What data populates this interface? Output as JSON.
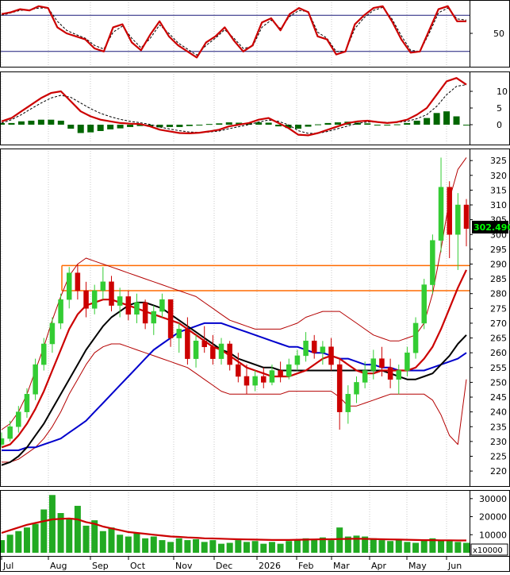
{
  "colors": {
    "background": "#ffffff",
    "frame": "#000000",
    "grid": "#c8c8c8",
    "up_candle": "#33cc33",
    "down_candle": "#cc0000",
    "ma_red": "#cc0000",
    "ma_black": "#000000",
    "ma_blue": "#0000cc",
    "bollinger": "#b40000",
    "resistance": "#ff6a00",
    "stoch_main": "#cc0000",
    "stoch_signal": "#000000",
    "stoch_levels": "#1a1a7a",
    "macd_line": "#cc0000",
    "macd_signal": "#000000",
    "macd_hist": "#006600",
    "volume_bar": "#22aa22",
    "volume_ma": "#cc0000",
    "price_tag_bg": "#000000",
    "price_tag_text": "#00ff00"
  },
  "chart_data": [
    {
      "panel": "stochastic",
      "type": "line",
      "x_labels": [
        "Jul",
        "Aug",
        "Sep",
        "Oct",
        "Nov",
        "Dec",
        "2026",
        "Feb",
        "Mar",
        "Apr",
        "May",
        "Jun"
      ],
      "ylim": [
        0,
        100
      ],
      "yticks": [
        "50"
      ],
      "levels": [
        80,
        20
      ],
      "grid": true,
      "series": [
        {
          "role": "main",
          "values": [
            82,
            85,
            90,
            88,
            95,
            92,
            60,
            50,
            45,
            40,
            25,
            20,
            60,
            65,
            35,
            22,
            48,
            70,
            45,
            30,
            20,
            10,
            35,
            45,
            60,
            38,
            20,
            30,
            68,
            75,
            55,
            82,
            92,
            85,
            45,
            40,
            15,
            20,
            65,
            80,
            92,
            95,
            70,
            40,
            18,
            20,
            55,
            90,
            95,
            70,
            70
          ]
        },
        {
          "role": "signal",
          "values": [
            80,
            84,
            88,
            89,
            92,
            92,
            70,
            55,
            48,
            42,
            30,
            24,
            52,
            62,
            42,
            26,
            42,
            64,
            50,
            34,
            24,
            14,
            30,
            42,
            56,
            42,
            25,
            28,
            60,
            72,
            58,
            78,
            88,
            86,
            52,
            42,
            20,
            20,
            58,
            76,
            88,
            93,
            74,
            46,
            22,
            20,
            50,
            84,
            92,
            74,
            72
          ]
        }
      ]
    },
    {
      "panel": "macd",
      "type": "line",
      "ylim": [
        -5,
        15
      ],
      "yticks": [
        "10",
        "5",
        "0"
      ],
      "grid": true,
      "series": [
        {
          "role": "macd",
          "values": [
            1,
            2,
            4,
            6,
            8,
            9.5,
            10,
            7,
            4,
            2.5,
            1.5,
            1,
            0.5,
            0.3,
            0.2,
            -0.5,
            -1.5,
            -2,
            -2.5,
            -2.6,
            -2.4,
            -2,
            -1.5,
            -0.5,
            0,
            0.5,
            1.5,
            2,
            0.5,
            -1,
            -3,
            -3.2,
            -2.5,
            -1.5,
            -0.5,
            0.5,
            1,
            1.2,
            0.8,
            0.5,
            0.8,
            1.5,
            3,
            5,
            9,
            13,
            14,
            12
          ]
        },
        {
          "role": "signal",
          "values": [
            0.5,
            1.5,
            3,
            4.8,
            6.5,
            8,
            8.8,
            8.2,
            6.5,
            4.8,
            3.4,
            2.4,
            1.6,
            1,
            0.6,
            0.1,
            -0.7,
            -1.3,
            -1.8,
            -2.2,
            -2.3,
            -2.2,
            -1.9,
            -1.2,
            -0.6,
            0,
            0.8,
            1.4,
            1,
            0,
            -1.8,
            -2.6,
            -2.6,
            -2,
            -1.2,
            -0.4,
            0.4,
            0.8,
            0.8,
            0.7,
            0.7,
            1,
            1.8,
            3,
            5.5,
            9,
            11.5,
            12
          ]
        },
        {
          "role": "histogram",
          "values": [
            0.5,
            0.5,
            1,
            1.2,
            1.5,
            1.5,
            1.2,
            -1.2,
            -2.5,
            -2.3,
            -1.9,
            -1.4,
            -1.1,
            -0.7,
            -0.4,
            -0.6,
            -0.8,
            -0.7,
            -0.7,
            -0.4,
            -0.1,
            0.2,
            0.4,
            0.7,
            0.6,
            0.5,
            0.7,
            0.6,
            -0.5,
            -1,
            -1.2,
            -0.6,
            0.1,
            0.5,
            0.7,
            0.9,
            0.6,
            0.4,
            0,
            -0.2,
            0.1,
            0.5,
            1.2,
            2,
            3.5,
            4,
            2.5,
            0
          ]
        }
      ]
    },
    {
      "panel": "price",
      "type": "candlestick",
      "ylim": [
        216,
        328
      ],
      "yticks": [
        "325",
        "320",
        "315",
        "310",
        "305",
        "300",
        "295",
        "290",
        "285",
        "280",
        "275",
        "270",
        "265",
        "260",
        "255",
        "250",
        "245",
        "240",
        "235",
        "230",
        "225",
        "220"
      ],
      "last_price": "302.490",
      "levels": [
        289.5,
        281
      ],
      "candles": [
        [
          229,
          233,
          228,
          231
        ],
        [
          231,
          237,
          230,
          235
        ],
        [
          235,
          242,
          233,
          240
        ],
        [
          240,
          248,
          238,
          246
        ],
        [
          246,
          258,
          244,
          256
        ],
        [
          256,
          265,
          254,
          263
        ],
        [
          263,
          272,
          260,
          270
        ],
        [
          270,
          280,
          268,
          278
        ],
        [
          278,
          289,
          275,
          287
        ],
        [
          287,
          290,
          278,
          281
        ],
        [
          281,
          284,
          272,
          275
        ],
        [
          275,
          283,
          273,
          281
        ],
        [
          281,
          289,
          278,
          284
        ],
        [
          284,
          286,
          274,
          276
        ],
        [
          276,
          282,
          272,
          279
        ],
        [
          279,
          281,
          271,
          273
        ],
        [
          273,
          280,
          270,
          277
        ],
        [
          277,
          278,
          268,
          270
        ],
        [
          270,
          276,
          266,
          274
        ],
        [
          274,
          280,
          272,
          278
        ],
        [
          278,
          278,
          262,
          265
        ],
        [
          265,
          270,
          260,
          268
        ],
        [
          268,
          272,
          256,
          258
        ],
        [
          258,
          266,
          255,
          264
        ],
        [
          264,
          269,
          260,
          262
        ],
        [
          262,
          266,
          256,
          258
        ],
        [
          258,
          265,
          256,
          263
        ],
        [
          263,
          264,
          254,
          256
        ],
        [
          256,
          260,
          250,
          252
        ],
        [
          252,
          256,
          246,
          249
        ],
        [
          249,
          254,
          247,
          252
        ],
        [
          252,
          255,
          248,
          250
        ],
        [
          250,
          256,
          249,
          254
        ],
        [
          254,
          257,
          250,
          252
        ],
        [
          252,
          258,
          251,
          256
        ],
        [
          256,
          261,
          254,
          259
        ],
        [
          259,
          267,
          257,
          264
        ],
        [
          264,
          266,
          258,
          260
        ],
        [
          260,
          264,
          256,
          262
        ],
        [
          262,
          265,
          254,
          256
        ],
        [
          256,
          258,
          234,
          240
        ],
        [
          240,
          249,
          236,
          246
        ],
        [
          246,
          252,
          243,
          250
        ],
        [
          250,
          257,
          248,
          254
        ],
        [
          254,
          261,
          251,
          258
        ],
        [
          258,
          262,
          252,
          255
        ],
        [
          255,
          258,
          248,
          251
        ],
        [
          251,
          256,
          246,
          254
        ],
        [
          254,
          262,
          252,
          260
        ],
        [
          260,
          272,
          258,
          270
        ],
        [
          270,
          285,
          268,
          283
        ],
        [
          283,
          300,
          280,
          298
        ],
        [
          298,
          326,
          294,
          316
        ],
        [
          316,
          318,
          292,
          300
        ],
        [
          300,
          314,
          288,
          310
        ],
        [
          310,
          312,
          296,
          302
        ]
      ],
      "series": [
        {
          "role": "ma_red",
          "values": [
            228,
            229,
            232,
            236,
            241,
            247,
            254,
            261,
            268,
            273,
            276,
            277,
            278,
            278,
            277,
            276,
            275,
            274,
            273,
            272,
            271,
            270,
            268,
            266,
            264,
            262,
            261,
            259,
            257,
            255,
            254,
            253,
            252,
            252,
            252,
            253,
            254,
            256,
            258,
            259,
            258,
            256,
            254,
            253,
            253,
            254,
            254,
            254,
            254,
            255,
            258,
            262,
            268,
            275,
            282,
            288
          ]
        },
        {
          "role": "ma_black",
          "values": [
            222,
            223,
            225,
            228,
            232,
            236,
            241,
            246,
            251,
            256,
            261,
            265,
            269,
            272,
            274,
            276,
            277,
            277,
            276,
            275,
            273,
            271,
            269,
            267,
            265,
            263,
            261,
            260,
            258,
            257,
            256,
            255,
            255,
            254,
            254,
            254,
            254,
            254,
            254,
            254,
            254,
            254,
            254,
            254,
            254,
            254,
            253,
            252,
            251,
            251,
            252,
            253,
            256,
            259,
            263,
            266
          ]
        },
        {
          "role": "ma_blue",
          "values": [
            227,
            227,
            227,
            228,
            228,
            229,
            230,
            231,
            233,
            235,
            237,
            240,
            243,
            246,
            249,
            252,
            255,
            258,
            261,
            263,
            265,
            267,
            268,
            269,
            270,
            270,
            270,
            269,
            268,
            267,
            266,
            265,
            264,
            263,
            262,
            262,
            261,
            260,
            260,
            259,
            258,
            258,
            257,
            256,
            256,
            255,
            255,
            254,
            254,
            254,
            254,
            255,
            256,
            257,
            258,
            260
          ]
        },
        {
          "role": "boll_upper",
          "values": [
            234,
            236,
            240,
            246,
            254,
            262,
            271,
            279,
            286,
            290,
            292,
            291,
            290,
            289,
            288,
            287,
            286,
            285,
            284,
            283,
            282,
            281,
            280,
            279,
            277,
            275,
            273,
            271,
            270,
            269,
            268,
            268,
            268,
            268,
            269,
            270,
            272,
            273,
            274,
            274,
            274,
            272,
            270,
            268,
            266,
            265,
            264,
            264,
            265,
            266,
            270,
            280,
            295,
            312,
            322,
            326
          ]
        },
        {
          "role": "boll_lower",
          "values": [
            223,
            223,
            224,
            226,
            228,
            231,
            235,
            240,
            246,
            251,
            256,
            260,
            262,
            263,
            263,
            262,
            261,
            260,
            259,
            258,
            257,
            256,
            255,
            253,
            251,
            249,
            247,
            246,
            246,
            246,
            246,
            246,
            246,
            246,
            247,
            247,
            247,
            247,
            247,
            247,
            245,
            242,
            242,
            243,
            244,
            245,
            246,
            246,
            246,
            246,
            246,
            244,
            239,
            232,
            229,
            251
          ]
        }
      ]
    },
    {
      "panel": "volume",
      "type": "bar",
      "yticks": [
        "30000",
        "20000",
        "10000"
      ],
      "unit_label": "x10000",
      "grid": true,
      "values": [
        7000,
        10000,
        12000,
        14000,
        16000,
        24000,
        32000,
        22000,
        19000,
        26000,
        15000,
        18000,
        12000,
        14000,
        10000,
        9000,
        11000,
        8000,
        9000,
        7000,
        6000,
        8000,
        7000,
        7500,
        6000,
        7000,
        5000,
        5500,
        7000,
        6000,
        6500,
        5000,
        6000,
        5000,
        6500,
        7000,
        8000,
        7500,
        8500,
        7000,
        14000,
        9000,
        9500,
        9000,
        8000,
        7000,
        6500,
        7000,
        6000,
        5500,
        7000,
        8000,
        7000,
        6500,
        6000,
        5500
      ],
      "series": [
        {
          "role": "volume_ma",
          "values": [
            11000,
            12500,
            14000,
            15500,
            16500,
            17500,
            18500,
            18800,
            19000,
            18500,
            17000,
            16000,
            14500,
            13500,
            12500,
            11500,
            11000,
            10500,
            10000,
            9500,
            9000,
            8800,
            8500,
            8300,
            8000,
            7900,
            7800,
            7600,
            7500,
            7400,
            7300,
            7200,
            7100,
            7100,
            7100,
            7200,
            7300,
            7400,
            7500,
            7500,
            7600,
            7700,
            7800,
            7700,
            7600,
            7500,
            7400,
            7300,
            7200,
            7100,
            7000,
            7000,
            6900,
            6900,
            6800,
            6800
          ]
        }
      ]
    }
  ]
}
